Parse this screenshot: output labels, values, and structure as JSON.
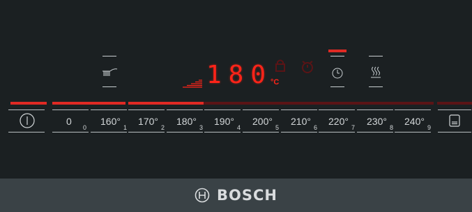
{
  "brand": {
    "name": "BOSCH"
  },
  "colors": {
    "panel_background": "#1b2022",
    "brand_strip": "#3a4246",
    "active_red": "#e02a24",
    "inactive_red": "#5a1416",
    "display_red": "#ff2419",
    "glyph_grey": "#c9cfd2"
  },
  "display": {
    "temperature_digits": "180",
    "unit": "°C",
    "mode_icon": "top-heat-grill-icon",
    "timer_icon": "clock-icon",
    "heat_icon": "steam-waves-icon",
    "timer_active": true
  },
  "controls": {
    "power_icon": "power-icon",
    "light_icon": "oven-light-icon"
  },
  "temperature_slider": {
    "active_level": 3,
    "levels": [
      {
        "label": "0",
        "index": "0"
      },
      {
        "label": "160°",
        "index": "1"
      },
      {
        "label": "170°",
        "index": "2"
      },
      {
        "label": "180°",
        "index": "3"
      },
      {
        "label": "190°",
        "index": "4"
      },
      {
        "label": "200°",
        "index": "5"
      },
      {
        "label": "210°",
        "index": "6"
      },
      {
        "label": "220°",
        "index": "7"
      },
      {
        "label": "230°",
        "index": "8"
      },
      {
        "label": "240°",
        "index": "9"
      }
    ]
  }
}
